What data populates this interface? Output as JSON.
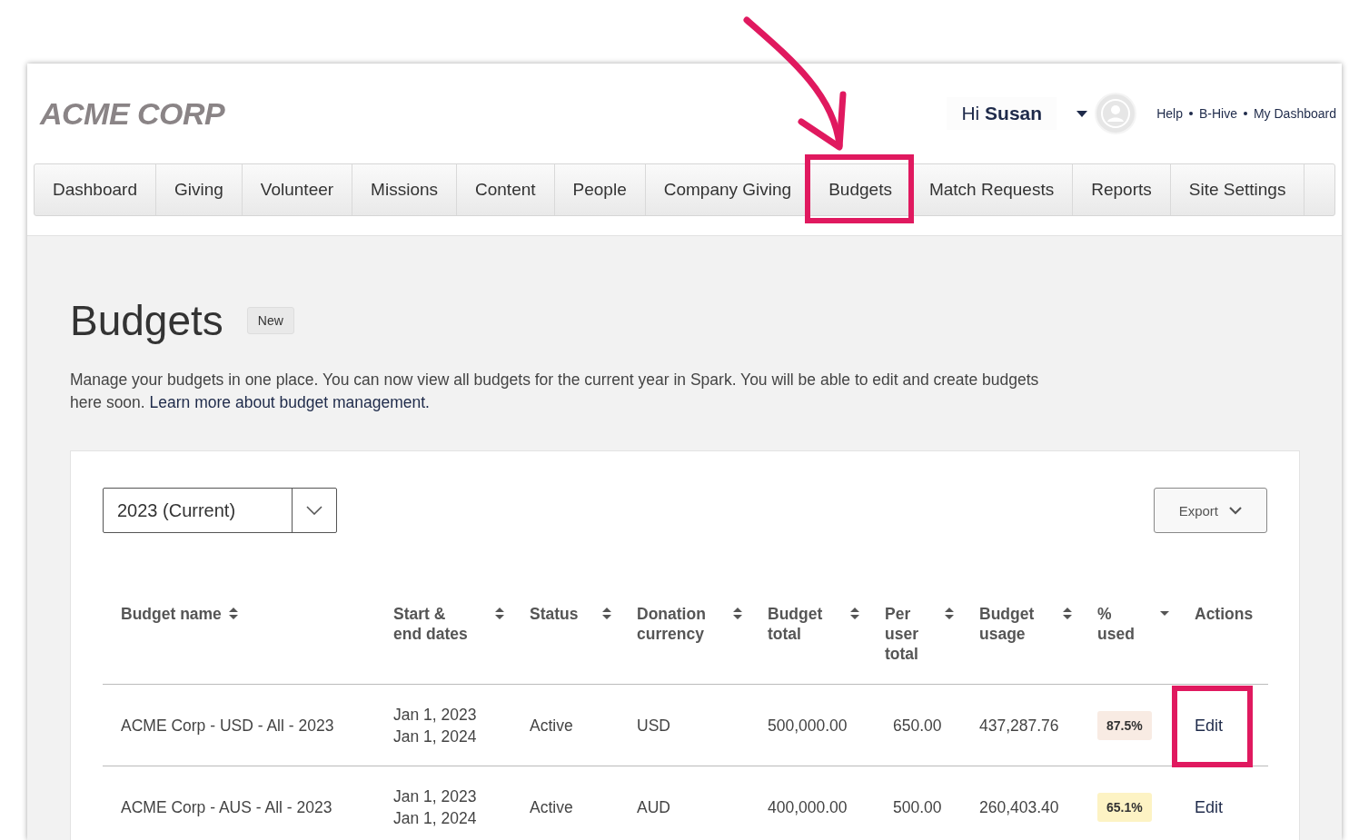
{
  "header": {
    "logo": "ACME CORP",
    "greeting": "Hi **Susan**",
    "links": [
      "Help",
      "B-Hive",
      "My Dashboard"
    ]
  },
  "nav": [
    {
      "label": "Dashboard",
      "selected": false,
      "annotated": false
    },
    {
      "label": "Giving",
      "selected": false,
      "annotated": false
    },
    {
      "label": "Volunteer",
      "selected": false,
      "annotated": false
    },
    {
      "label": "Missions",
      "selected": false,
      "annotated": false
    },
    {
      "label": "Content",
      "selected": false,
      "annotated": false
    },
    {
      "label": "People",
      "selected": false,
      "annotated": false
    },
    {
      "label": "Company Giving",
      "selected": false,
      "annotated": false
    },
    {
      "label": "Budgets",
      "selected": false,
      "annotated": true
    },
    {
      "label": "Match Requests",
      "selected": false,
      "annotated": false
    },
    {
      "label": "Reports",
      "selected": false,
      "annotated": false
    },
    {
      "label": "Site Settings",
      "selected": false,
      "annotated": false
    }
  ],
  "page": {
    "title": "Budgets",
    "badge": "New",
    "description": "Manage your budgets in one place. You can now view all budgets for the current year in Spark. You will be able to edit and create budgets here soon.",
    "link": "Learn more about budget management."
  },
  "toolbar": {
    "year_select": "2023 (Current)",
    "export_button": "Export"
  },
  "table": {
    "columns": [
      {
        "label": "Budget name",
        "sortable": true,
        "sorted": false
      },
      {
        "label": "Start & end dates",
        "sortable": true,
        "sorted": false
      },
      {
        "label": "Status",
        "sortable": true,
        "sorted": false
      },
      {
        "label": "Donation currency",
        "sortable": true,
        "sorted": false
      },
      {
        "label": "Budget total",
        "sortable": true,
        "sorted": false
      },
      {
        "label": "Per user total",
        "sortable": true,
        "sorted": false
      },
      {
        "label": "Budget usage",
        "sortable": true,
        "sorted": false
      },
      {
        "label": "% used",
        "sortable": true,
        "sorted": true
      },
      {
        "label": "Actions",
        "sortable": false,
        "sorted": false
      }
    ],
    "rows": [
      {
        "name": "ACME Corp - USD - All - 2023",
        "start": "Jan 1, 2023",
        "end": "Jan 1, 2024",
        "status": "Active",
        "currency": "USD",
        "total": "500,000.00",
        "per_user": "650.00",
        "usage": "437,287.76",
        "percent": "87.5%",
        "color": "#f8ebe3",
        "action": "Edit",
        "annotated": true
      },
      {
        "name": "ACME Corp - AUS - All - 2023",
        "start": "Jan 1, 2023",
        "end": "Jan 1, 2024",
        "status": "Active",
        "currency": "AUD",
        "total": "400,000.00",
        "per_user": "500.00",
        "usage": "260,403.40",
        "percent": "65.1%",
        "color": "#fdf3c4",
        "action": "Edit",
        "annotated": false
      }
    ]
  }
}
